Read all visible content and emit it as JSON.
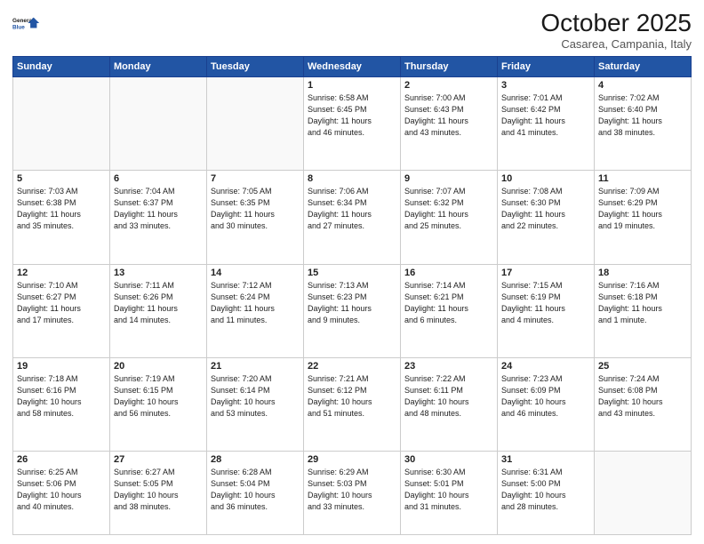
{
  "header": {
    "logo_line1": "General",
    "logo_line2": "Blue",
    "month": "October 2025",
    "location": "Casarea, Campania, Italy"
  },
  "weekdays": [
    "Sunday",
    "Monday",
    "Tuesday",
    "Wednesday",
    "Thursday",
    "Friday",
    "Saturday"
  ],
  "weeks": [
    [
      {
        "day": "",
        "info": ""
      },
      {
        "day": "",
        "info": ""
      },
      {
        "day": "",
        "info": ""
      },
      {
        "day": "1",
        "info": "Sunrise: 6:58 AM\nSunset: 6:45 PM\nDaylight: 11 hours\nand 46 minutes."
      },
      {
        "day": "2",
        "info": "Sunrise: 7:00 AM\nSunset: 6:43 PM\nDaylight: 11 hours\nand 43 minutes."
      },
      {
        "day": "3",
        "info": "Sunrise: 7:01 AM\nSunset: 6:42 PM\nDaylight: 11 hours\nand 41 minutes."
      },
      {
        "day": "4",
        "info": "Sunrise: 7:02 AM\nSunset: 6:40 PM\nDaylight: 11 hours\nand 38 minutes."
      }
    ],
    [
      {
        "day": "5",
        "info": "Sunrise: 7:03 AM\nSunset: 6:38 PM\nDaylight: 11 hours\nand 35 minutes."
      },
      {
        "day": "6",
        "info": "Sunrise: 7:04 AM\nSunset: 6:37 PM\nDaylight: 11 hours\nand 33 minutes."
      },
      {
        "day": "7",
        "info": "Sunrise: 7:05 AM\nSunset: 6:35 PM\nDaylight: 11 hours\nand 30 minutes."
      },
      {
        "day": "8",
        "info": "Sunrise: 7:06 AM\nSunset: 6:34 PM\nDaylight: 11 hours\nand 27 minutes."
      },
      {
        "day": "9",
        "info": "Sunrise: 7:07 AM\nSunset: 6:32 PM\nDaylight: 11 hours\nand 25 minutes."
      },
      {
        "day": "10",
        "info": "Sunrise: 7:08 AM\nSunset: 6:30 PM\nDaylight: 11 hours\nand 22 minutes."
      },
      {
        "day": "11",
        "info": "Sunrise: 7:09 AM\nSunset: 6:29 PM\nDaylight: 11 hours\nand 19 minutes."
      }
    ],
    [
      {
        "day": "12",
        "info": "Sunrise: 7:10 AM\nSunset: 6:27 PM\nDaylight: 11 hours\nand 17 minutes."
      },
      {
        "day": "13",
        "info": "Sunrise: 7:11 AM\nSunset: 6:26 PM\nDaylight: 11 hours\nand 14 minutes."
      },
      {
        "day": "14",
        "info": "Sunrise: 7:12 AM\nSunset: 6:24 PM\nDaylight: 11 hours\nand 11 minutes."
      },
      {
        "day": "15",
        "info": "Sunrise: 7:13 AM\nSunset: 6:23 PM\nDaylight: 11 hours\nand 9 minutes."
      },
      {
        "day": "16",
        "info": "Sunrise: 7:14 AM\nSunset: 6:21 PM\nDaylight: 11 hours\nand 6 minutes."
      },
      {
        "day": "17",
        "info": "Sunrise: 7:15 AM\nSunset: 6:19 PM\nDaylight: 11 hours\nand 4 minutes."
      },
      {
        "day": "18",
        "info": "Sunrise: 7:16 AM\nSunset: 6:18 PM\nDaylight: 11 hours\nand 1 minute."
      }
    ],
    [
      {
        "day": "19",
        "info": "Sunrise: 7:18 AM\nSunset: 6:16 PM\nDaylight: 10 hours\nand 58 minutes."
      },
      {
        "day": "20",
        "info": "Sunrise: 7:19 AM\nSunset: 6:15 PM\nDaylight: 10 hours\nand 56 minutes."
      },
      {
        "day": "21",
        "info": "Sunrise: 7:20 AM\nSunset: 6:14 PM\nDaylight: 10 hours\nand 53 minutes."
      },
      {
        "day": "22",
        "info": "Sunrise: 7:21 AM\nSunset: 6:12 PM\nDaylight: 10 hours\nand 51 minutes."
      },
      {
        "day": "23",
        "info": "Sunrise: 7:22 AM\nSunset: 6:11 PM\nDaylight: 10 hours\nand 48 minutes."
      },
      {
        "day": "24",
        "info": "Sunrise: 7:23 AM\nSunset: 6:09 PM\nDaylight: 10 hours\nand 46 minutes."
      },
      {
        "day": "25",
        "info": "Sunrise: 7:24 AM\nSunset: 6:08 PM\nDaylight: 10 hours\nand 43 minutes."
      }
    ],
    [
      {
        "day": "26",
        "info": "Sunrise: 6:25 AM\nSunset: 5:06 PM\nDaylight: 10 hours\nand 40 minutes."
      },
      {
        "day": "27",
        "info": "Sunrise: 6:27 AM\nSunset: 5:05 PM\nDaylight: 10 hours\nand 38 minutes."
      },
      {
        "day": "28",
        "info": "Sunrise: 6:28 AM\nSunset: 5:04 PM\nDaylight: 10 hours\nand 36 minutes."
      },
      {
        "day": "29",
        "info": "Sunrise: 6:29 AM\nSunset: 5:03 PM\nDaylight: 10 hours\nand 33 minutes."
      },
      {
        "day": "30",
        "info": "Sunrise: 6:30 AM\nSunset: 5:01 PM\nDaylight: 10 hours\nand 31 minutes."
      },
      {
        "day": "31",
        "info": "Sunrise: 6:31 AM\nSunset: 5:00 PM\nDaylight: 10 hours\nand 28 minutes."
      },
      {
        "day": "",
        "info": ""
      }
    ]
  ]
}
